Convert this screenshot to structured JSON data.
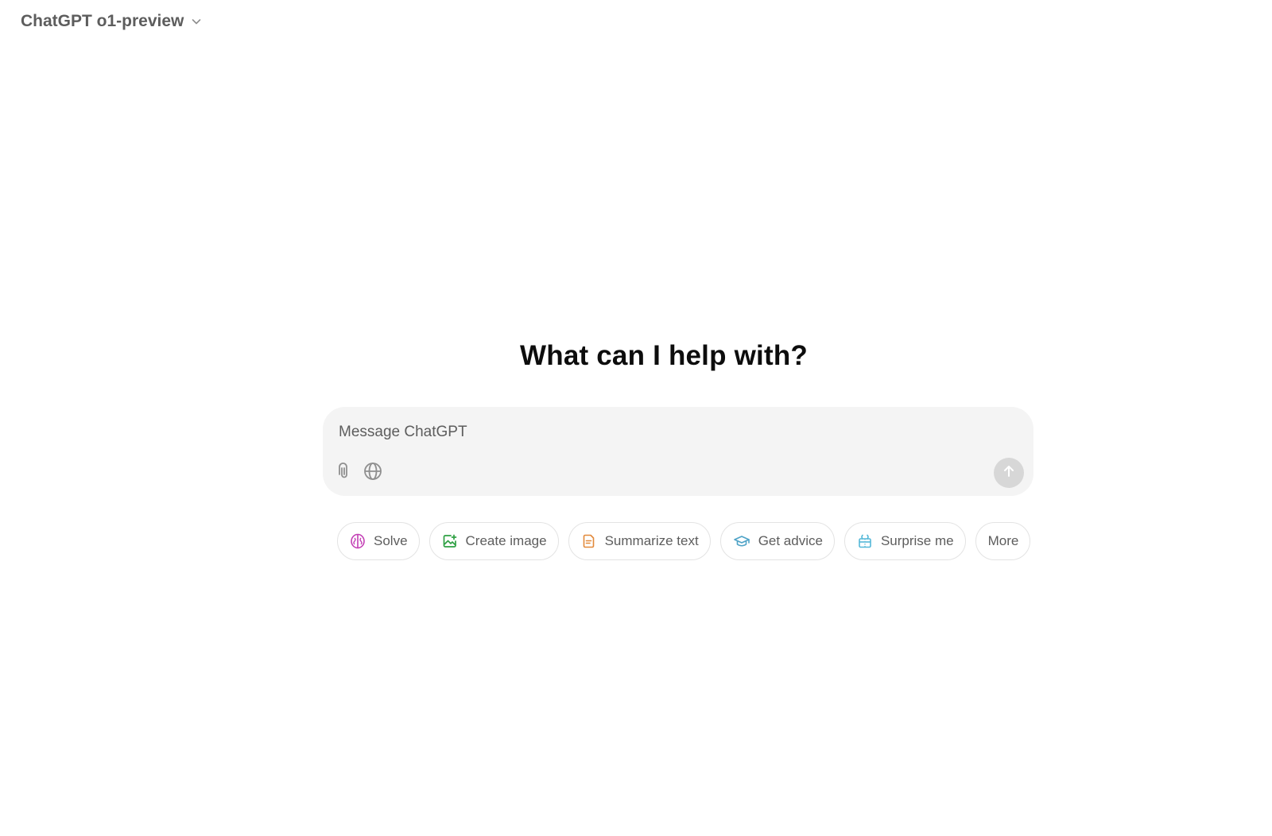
{
  "header": {
    "model_name": "ChatGPT o1-preview",
    "chevron_icon": "chevron-down-icon"
  },
  "main": {
    "headline": "What can I help with?"
  },
  "composer": {
    "placeholder": "Message ChatGPT",
    "value": "",
    "tools": [
      {
        "icon": "paperclip-icon"
      },
      {
        "icon": "globe-icon"
      }
    ],
    "send_icon": "arrow-up-icon"
  },
  "suggestions": [
    {
      "label": "Solve",
      "icon": "brain-icon",
      "color": "#c33fb5"
    },
    {
      "label": "Create image",
      "icon": "image-icon",
      "color": "#2ea043"
    },
    {
      "label": "Summarize text",
      "icon": "document-icon",
      "color": "#e2893a"
    },
    {
      "label": "Get advice",
      "icon": "graduation-cap-icon",
      "color": "#4fa3c7"
    },
    {
      "label": "Surprise me",
      "icon": "gift-icon",
      "color": "#55b8d8"
    },
    {
      "label": "More"
    }
  ],
  "colors": {
    "background": "#ffffff",
    "composer_background": "#f4f4f4",
    "muted_text": "#5d5d5d",
    "send_button_disabled": "#d7d7d7"
  }
}
